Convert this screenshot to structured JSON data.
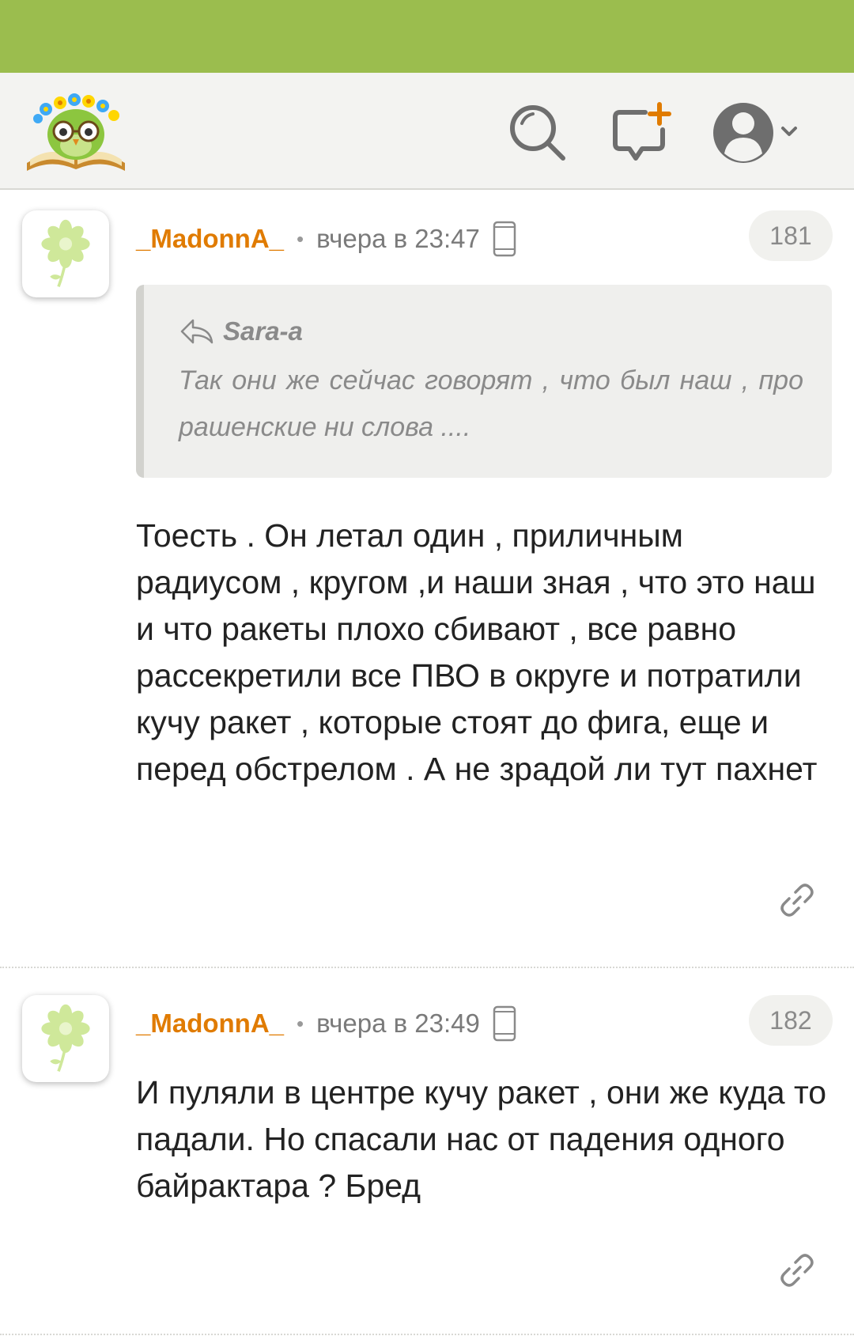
{
  "header": {
    "logo_icon": "owl-reading-book-logo",
    "search_icon": "search-icon",
    "new_post_icon": "new-post-icon",
    "user_icon": "user-avatar-icon",
    "dropdown_icon": "chevron-down-icon"
  },
  "colors": {
    "top_bar": "#9bbd4e",
    "header_bg": "#f3f3f1",
    "author": "#e07b00",
    "meta_text": "#7a7a7a"
  },
  "comments": [
    {
      "author": "_MadonnA_",
      "separator": "•",
      "time": "вчера в 23:47",
      "device_icon": "mobile-phone-icon",
      "number": "181",
      "quote": {
        "author": "Sara-a",
        "text": "Так они же сейчас говорят , что был наш , про рашенские ни слова ...."
      },
      "text": "Тоесть . Он летал один , приличным радиусом , кругом ,и наши зная , что это наш и что ракеты плохо сбивают , все равно рассекретили все ПВО в округе и потратили кучу ракет , которые стоят до фига, еще и перед обстрелом . А не зрадой ли тут пахнет",
      "link_icon": "link-icon"
    },
    {
      "author": "_MadonnA_",
      "separator": "•",
      "time": "вчера в 23:49",
      "device_icon": "mobile-phone-icon",
      "number": "182",
      "text": "И пуляли в центре кучу ракет , они же куда то падали. Но спасали нас от падения одного байрактара ? Бред",
      "link_icon": "link-icon"
    }
  ]
}
